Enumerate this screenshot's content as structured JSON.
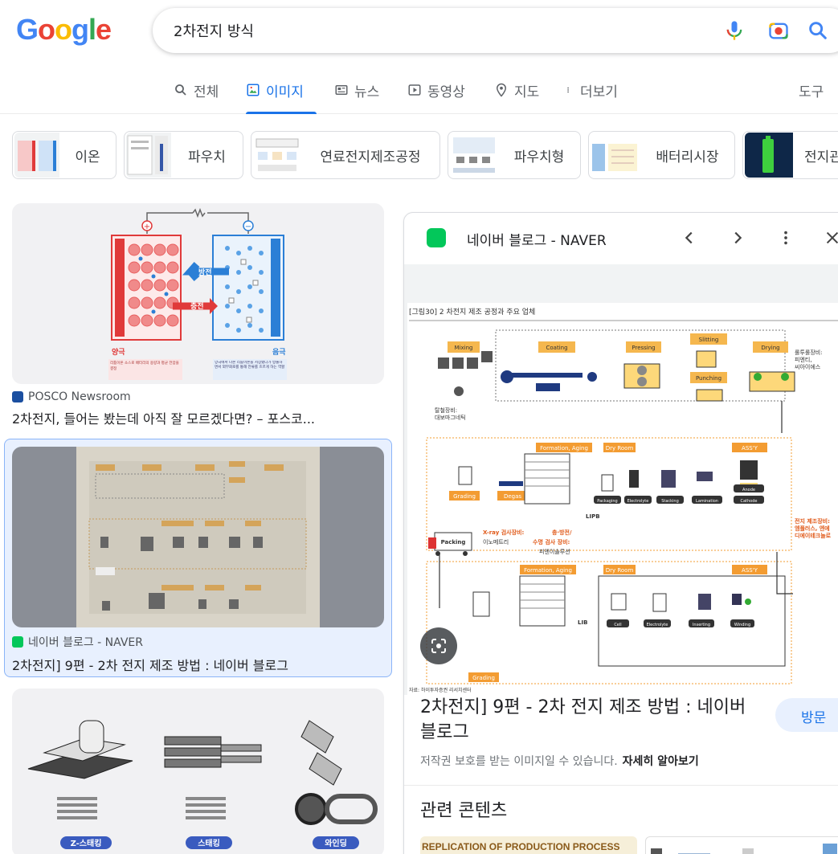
{
  "search": {
    "query": "2차전지 방식"
  },
  "tabs": [
    "전체",
    "이미지",
    "뉴스",
    "동영상",
    "지도",
    "더보기"
  ],
  "tools_label": "도구",
  "chips": [
    {
      "label": "이온"
    },
    {
      "label": "파우치"
    },
    {
      "label": "연료전지제조공정"
    },
    {
      "label": "파우치형"
    },
    {
      "label": "배터리시장"
    },
    {
      "label": "전지관"
    }
  ],
  "results": [
    {
      "source": "POSCO Newsroom",
      "title": "2차전지, 들어는 봤는데 아직 잘 모르겠다면? – 포스코..."
    },
    {
      "source": "네이버 블로그 - NAVER",
      "title": "2차전지] 9편 - 2차 전지 제조 방법 : 네이버 블로그"
    }
  ],
  "battery_diagram": {
    "discharge_label": "방전",
    "charge_label": "충전",
    "cathode_label": "양극",
    "anode_label": "음극",
    "cathode_desc": "리튬이온 소스로 배터리의 용량과 평균 전압을 결정",
    "anode_desc": "양극에서 나온 리튬이온을 저장했다가 방출하면서 외부회로를 통해 전류를 흐르게 하는 역할"
  },
  "stacking_diagram": {
    "labels": [
      "Z-스태킹",
      "스태킹",
      "와인딩"
    ]
  },
  "panel": {
    "source": "네이버 블로그 - NAVER",
    "title": "2차전지] 9편 - 2차 전지 제조 방법 : 네이버 블로그",
    "visit_label": "방문",
    "copyright": "저작권 보호를 받는 이미지일 수 있습니다.",
    "learn_more": "자세히 알아보기",
    "related_label": "관련 콘텐츠",
    "related_caption": "REPLICATION OF PRODUCTION PROCESS"
  },
  "figure": {
    "caption": "[그림30]  2 차전지 제조 공정과 주요 업체",
    "source_note": "자료: 하이투자증권 리서치센터",
    "row1": [
      "Mixing",
      "Coating",
      "Pressing",
      "Slitting",
      "Punching",
      "Drying"
    ],
    "row2": [
      "Formation, Aging",
      "Dry Room",
      "ASS'Y"
    ],
    "row2_steps": [
      "Grading",
      "Degas",
      "Packaging",
      "Electrolyte",
      "Stacking",
      "Lamination",
      "Anode",
      "Cathode"
    ],
    "row3": [
      "Formation, Aging",
      "Dry Room",
      "ASS'Y"
    ],
    "row3_steps": [
      "Grading",
      "Cell",
      "Electrolyte",
      "Inserting",
      "Winding"
    ],
    "lipb": "LIPB",
    "lib": "LIB",
    "packing": "Packing",
    "vendor_roll": "롤투롤장비:\n피엔티,\n씨아이에스",
    "vendor_tal": "탈철장비:\n대보마그네틱",
    "vendor_cell": "전지 제조장비:\n엠플러스, 엔에\n디에이테크놀로",
    "xray_label": "X-ray 검사장비:",
    "xray_vendor": "이노메트리",
    "charge_label": "충·방전/",
    "charge_label2": "수명 검사 장비:",
    "charge_vendor": "피엔이솔루션"
  },
  "colors": {
    "accent": "#1a73e8",
    "orange": "#f39c32",
    "red_plate": "#e03a3a",
    "blue_plate": "#2b7fd6"
  }
}
